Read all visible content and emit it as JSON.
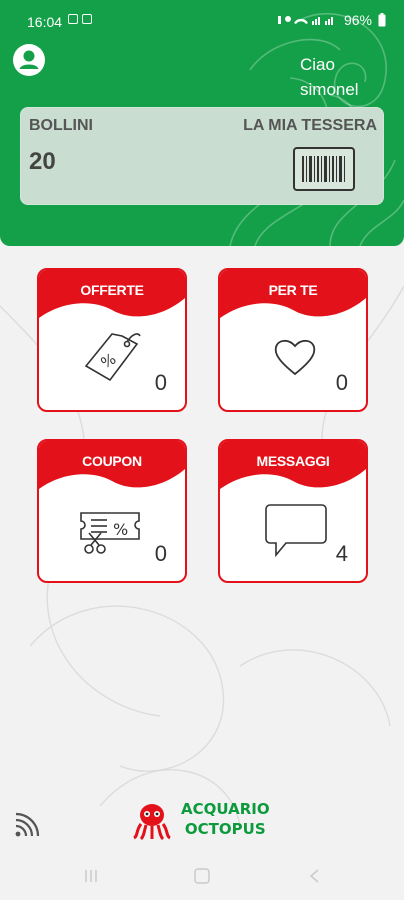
{
  "status_bar": {
    "time": "16:04",
    "battery": "96%"
  },
  "header": {
    "greeting": "Ciao simonel"
  },
  "card": {
    "points_label": "BOLLINI",
    "points_value": "20",
    "card_title": "LA MIA TESSERA"
  },
  "tiles": [
    {
      "title": "OFFERTE",
      "count": "0",
      "icon": "discount-tag-icon"
    },
    {
      "title": "PER TE",
      "count": "0",
      "icon": "heart-icon"
    },
    {
      "title": "COUPON",
      "count": "0",
      "icon": "coupon-scissors-icon"
    },
    {
      "title": "MESSAGGI",
      "count": "4",
      "icon": "message-bubble-icon"
    }
  ],
  "brand": {
    "line1": "ACQUARIO",
    "line2": "OCTOPUS"
  },
  "colors": {
    "header_green": "#14a048",
    "tile_red": "#e3121a",
    "brand_green": "#0d9a3c"
  }
}
